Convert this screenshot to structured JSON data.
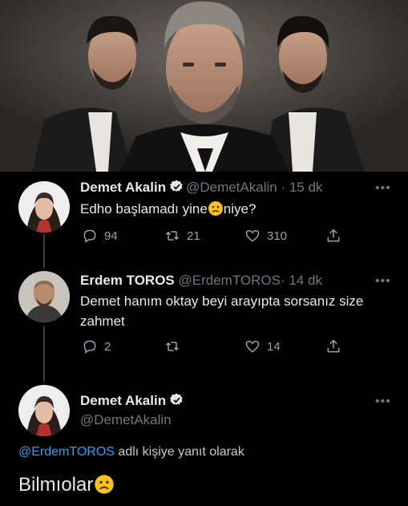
{
  "colors": {
    "background": "#000000",
    "accent": "#1d9bf0",
    "muted": "#71767b"
  },
  "tweets": [
    {
      "name": "Demet Akalin",
      "handle": "@DemetAkalin",
      "time": "· 15 dk",
      "text_before": "Edho başlamadı yine",
      "text_after": "niye?",
      "replies": "94",
      "retweets": "21",
      "likes": "310",
      "verified": true
    },
    {
      "name": "Erdem TOROS",
      "handle": "@ErdemTOROS",
      "time": "· 14 dk",
      "text_line1": "Demet hanım oktay beyi arayıpta sorsanız size",
      "text_line2": "zahmet",
      "replies": "2",
      "retweets": "",
      "likes": "14",
      "verified": false
    }
  ],
  "focused_tweet": {
    "name": "Demet Akalin",
    "handle": "@DemetAkalin",
    "reply_mention": "@ErdemTOROS",
    "reply_suffix": " adlı kişiye yanıt olarak",
    "text": "Bilmıolar"
  },
  "icons": [
    "reply-icon",
    "retweet-icon",
    "like-icon",
    "share-icon",
    "verified-badge-icon",
    "more-icon",
    "frowning-face-emoji"
  ]
}
